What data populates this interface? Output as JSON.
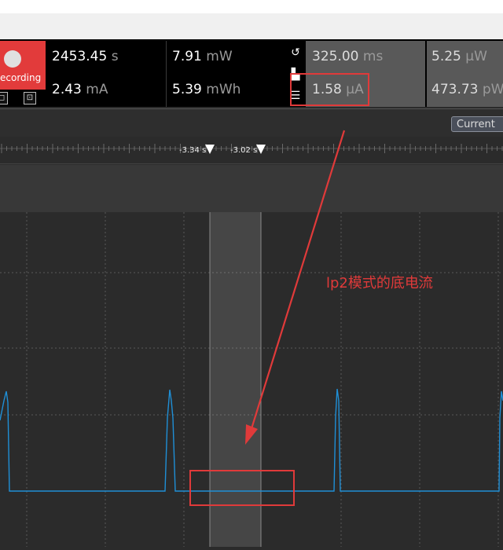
{
  "recorder": {
    "record_label": "ecording"
  },
  "stats": {
    "time": {
      "value": "2453.45",
      "unit": "s"
    },
    "current": {
      "value": "2.43",
      "unit": "mA"
    },
    "power": {
      "value": "7.91",
      "unit": "mW"
    },
    "energy": {
      "value": "5.39",
      "unit": "mWh"
    },
    "sel_time": {
      "value": "325.00",
      "unit": "ms"
    },
    "sel_current": {
      "value": "1.58",
      "unit": "µA"
    },
    "sel_power": {
      "value": "5.25",
      "unit": "µW"
    },
    "sel_energy": {
      "value": "473.73",
      "unit": "pW"
    }
  },
  "toolbar": {
    "channel_button": "Current"
  },
  "markers": {
    "left": "-3.34 s",
    "right": "-3.02 s"
  },
  "annotation": {
    "text": "lp2模式的底电流"
  },
  "colors": {
    "record": "#e23b3b",
    "trace": "#1f8fd6",
    "annotation": "#e03a3a"
  }
}
